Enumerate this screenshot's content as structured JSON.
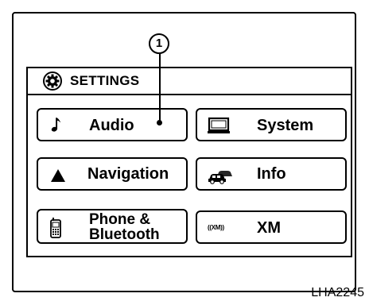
{
  "header": {
    "title": "SETTINGS",
    "icon": "gear-icon"
  },
  "menu": {
    "audio": {
      "label": "Audio",
      "icon": "music-note-icon"
    },
    "system": {
      "label": "System",
      "icon": "monitor-icon"
    },
    "navigation": {
      "label": "Navigation",
      "icon": "navigation-arrow-icon"
    },
    "info": {
      "label": "Info",
      "icon": "traffic-cars-icon"
    },
    "phone": {
      "label_line1": "Phone &",
      "label_line2": "Bluetooth",
      "icon": "cellphone-icon"
    },
    "xm": {
      "label": "XM",
      "icon_text": "((XM))",
      "icon": "xm-radio-icon"
    }
  },
  "callout": {
    "number": "1"
  },
  "figure_code": "LHA2245"
}
